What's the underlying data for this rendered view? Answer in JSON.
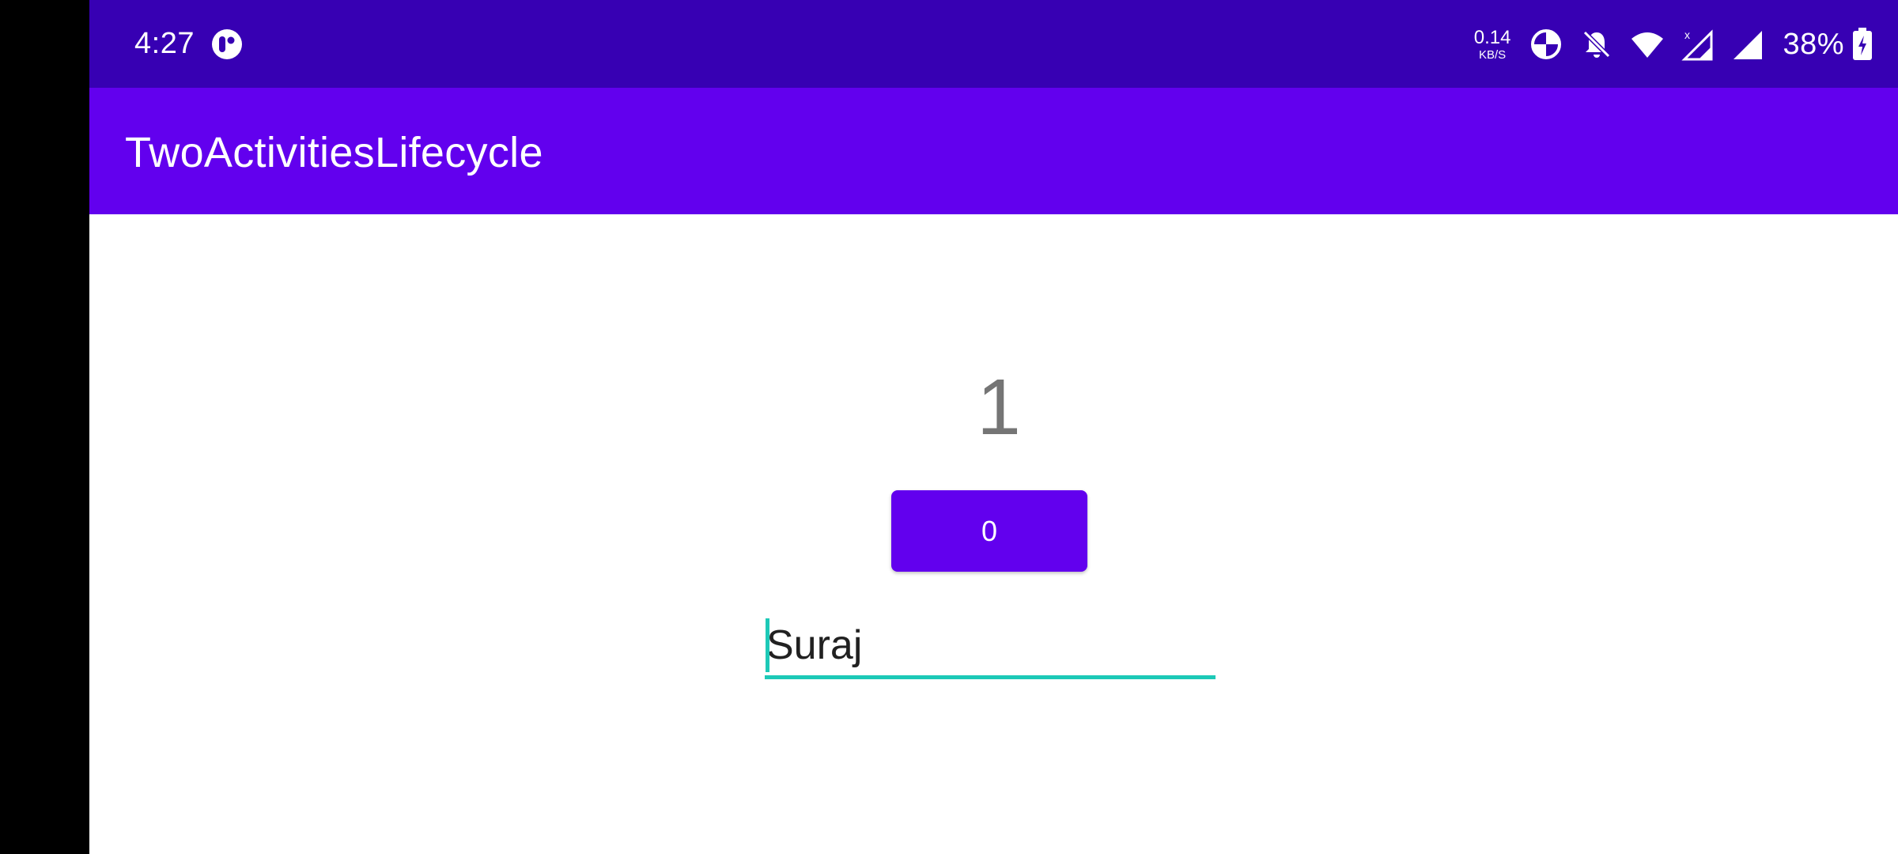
{
  "status_bar": {
    "time": "4:27",
    "network_speed_value": "0.14",
    "network_speed_unit": "KB/S",
    "battery_percent": "38%",
    "icons": [
      "app-notification-icon",
      "data-saver-icon",
      "muted-bell-icon",
      "wifi-icon",
      "cell-signal-x-icon",
      "cell-signal-icon",
      "battery-charging-icon"
    ]
  },
  "app_bar": {
    "title": "TwoActivitiesLifecycle"
  },
  "main": {
    "count": "1",
    "button_label": "0",
    "name_value": "Suraj"
  },
  "colors": {
    "status_bar": "#3700b3",
    "primary": "#6200ee",
    "accent": "#1dc9b7",
    "count_text": "#757575"
  }
}
